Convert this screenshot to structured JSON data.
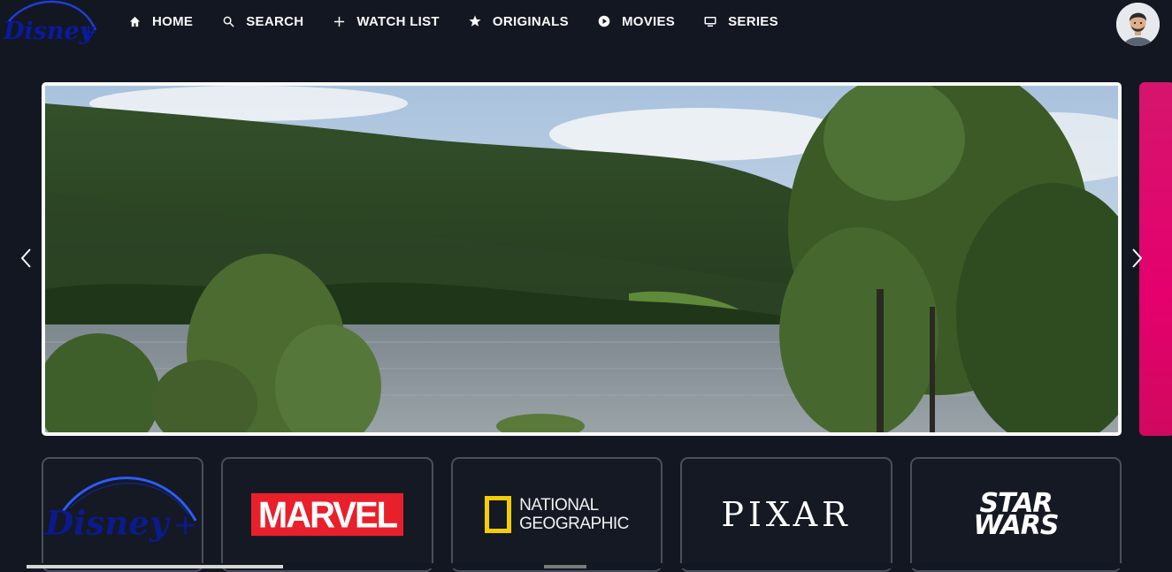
{
  "header": {
    "logo_text": "Disney+",
    "nav": [
      {
        "label": "HOME",
        "icon": "home-icon"
      },
      {
        "label": "SEARCH",
        "icon": "search-icon"
      },
      {
        "label": "WATCH LIST",
        "icon": "plus-icon"
      },
      {
        "label": "ORIGINALS",
        "icon": "star-icon"
      },
      {
        "label": "MOVIES",
        "icon": "play-icon"
      },
      {
        "label": "SERIES",
        "icon": "tv-icon"
      }
    ],
    "avatar": "user-avatar"
  },
  "carousel": {
    "slide": "lake-forest-landscape",
    "prev_icon": "chevron-left-icon",
    "next_icon": "chevron-right-icon"
  },
  "brands": [
    {
      "name": "Disney+",
      "logo_text": "Disney+"
    },
    {
      "name": "Marvel",
      "logo_text": "MARVEL"
    },
    {
      "name": "National Geographic",
      "logo_line1": "NATIONAL",
      "logo_line2": "GEOGRAPHIC"
    },
    {
      "name": "Pixar",
      "logo_text": "PIXAR"
    },
    {
      "name": "Star Wars",
      "logo_line1": "STAR",
      "logo_line2": "WARS"
    }
  ],
  "colors": {
    "background": "#131722",
    "text": "#f9f9f9",
    "accent_pink": "#e5006d",
    "marvel_red": "#e8202b",
    "natgeo_yellow": "#f5cc00",
    "disney_blue": "#0a1a9e"
  }
}
